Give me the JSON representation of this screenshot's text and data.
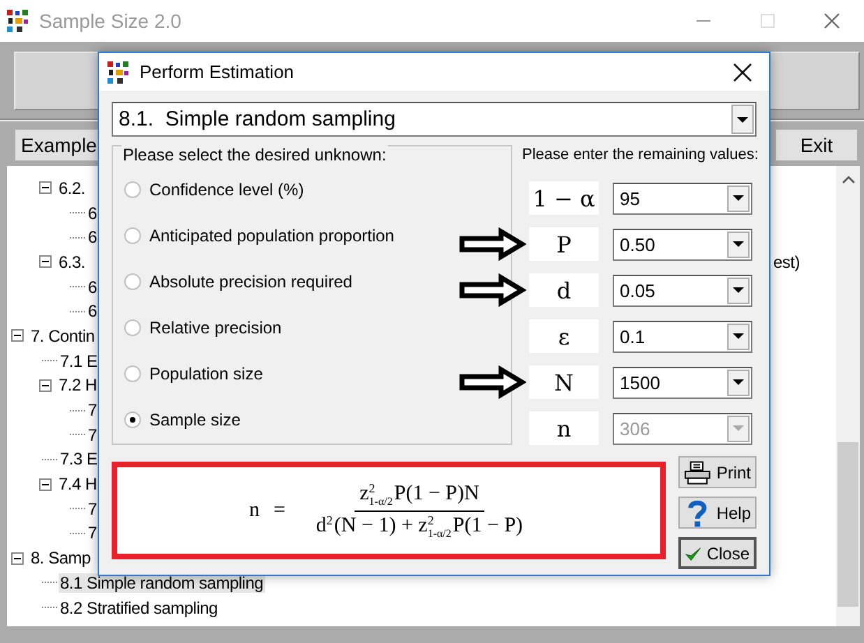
{
  "window": {
    "title": "Sample Size 2.0",
    "maximize_disabled": true
  },
  "toolbar": {
    "buttons": [
      {
        "label": "Example"
      },
      {
        "label": "Exit"
      }
    ]
  },
  "tree": {
    "items": [
      {
        "children": [
          {
            "label": "6.2.",
            "expanded": true,
            "selected": false,
            "children": [
              {
                "label": "6",
                "selected": false
              },
              {
                "label": "6",
                "selected": false
              }
            ]
          },
          {
            "label": "6.3.",
            "tail": "est)",
            "expanded": true,
            "selected": false,
            "children": [
              {
                "label": "6",
                "selected": false
              },
              {
                "label": "6",
                "selected": false
              }
            ]
          }
        ]
      },
      {
        "label": "7. Contin",
        "expanded": true,
        "selected": false,
        "children": [
          {
            "label": "7.1 E",
            "selected": false
          },
          {
            "label": "7.2 H",
            "expanded": true,
            "selected": false,
            "children": [
              {
                "label": "7",
                "selected": false
              },
              {
                "label": "7",
                "selected": false
              }
            ]
          },
          {
            "label": "7.3 E",
            "selected": false
          },
          {
            "label": "7.4 H",
            "expanded": true,
            "selected": false,
            "children": [
              {
                "label": "7",
                "selected": false
              },
              {
                "label": "7",
                "selected": false
              }
            ]
          }
        ]
      },
      {
        "label": "8. Samp",
        "expanded": true,
        "selected": false,
        "children": [
          {
            "label": "8.1 Simple random sampling",
            "selected": true
          },
          {
            "label": "8.2 Stratified sampling",
            "selected": false
          }
        ]
      }
    ]
  },
  "dialog": {
    "title": "Perform Estimation",
    "method": "8.1.  Simple random sampling",
    "unknown_group": {
      "title": "Please select the desired unknown:",
      "options": [
        {
          "label": "Confidence level (%)",
          "selected": false
        },
        {
          "label": "Anticipated population proportion",
          "selected": false
        },
        {
          "label": "Absolute precision required",
          "selected": false
        },
        {
          "label": "Relative precision",
          "selected": false
        },
        {
          "label": "Population size",
          "selected": false
        },
        {
          "label": "Sample size",
          "selected": true
        }
      ]
    },
    "values": {
      "title": "Please enter the remaining values:",
      "rows": [
        {
          "symbol": "1 − α",
          "value": "95",
          "disabled": false,
          "arrow": false
        },
        {
          "symbol": "P",
          "value": "0.50",
          "disabled": false,
          "arrow": true
        },
        {
          "symbol": "d",
          "value": "0.05",
          "disabled": false,
          "arrow": true
        },
        {
          "symbol": "ε",
          "value": "0.1",
          "disabled": false,
          "arrow": false
        },
        {
          "symbol": "N",
          "value": "1500",
          "disabled": false,
          "arrow": true
        },
        {
          "symbol": "n",
          "value": "306",
          "disabled": true,
          "arrow": false
        }
      ]
    },
    "formula": {
      "lhs": "n",
      "equals": "=",
      "numerator": [
        {
          "base": "z",
          "sup": "2",
          "sub": "1-α/2"
        },
        {
          "text": "P(1 − P)N"
        }
      ],
      "denominator": [
        {
          "base": "d",
          "sup": "2"
        },
        {
          "text": "(N − 1) + "
        },
        {
          "base": "z",
          "sup": "2",
          "sub": "1-α/2"
        },
        {
          "text": "P(1 − P)"
        }
      ]
    },
    "buttons": [
      {
        "label": "Print",
        "kind": "print"
      },
      {
        "label": "Help",
        "kind": "help"
      },
      {
        "label": "Close",
        "kind": "close"
      }
    ]
  }
}
